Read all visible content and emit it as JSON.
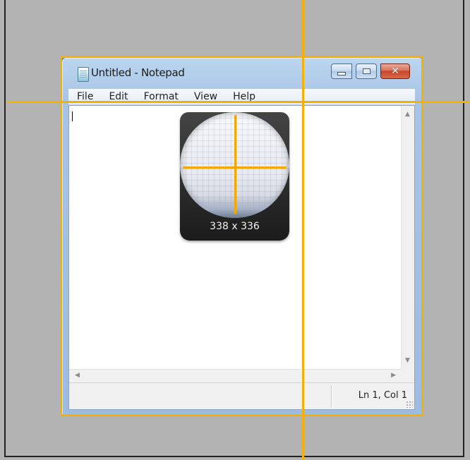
{
  "window": {
    "title": "Untitled - Notepad",
    "icon": "notepad-icon",
    "caption_buttons": [
      "minimize-icon",
      "maximize-icon",
      "close-icon"
    ]
  },
  "menubar": {
    "items": [
      {
        "label": "File"
      },
      {
        "label": "Edit"
      },
      {
        "label": "Format"
      },
      {
        "label": "View"
      },
      {
        "label": "Help"
      }
    ]
  },
  "editor": {
    "content": ""
  },
  "statusbar": {
    "position_text": "Ln 1, Col 1"
  },
  "magnifier": {
    "dimensions_label": "338 x 336"
  },
  "colors": {
    "guide": "#f5b000",
    "desktop": "#b3b3b3",
    "close_button": "#c6452a"
  }
}
